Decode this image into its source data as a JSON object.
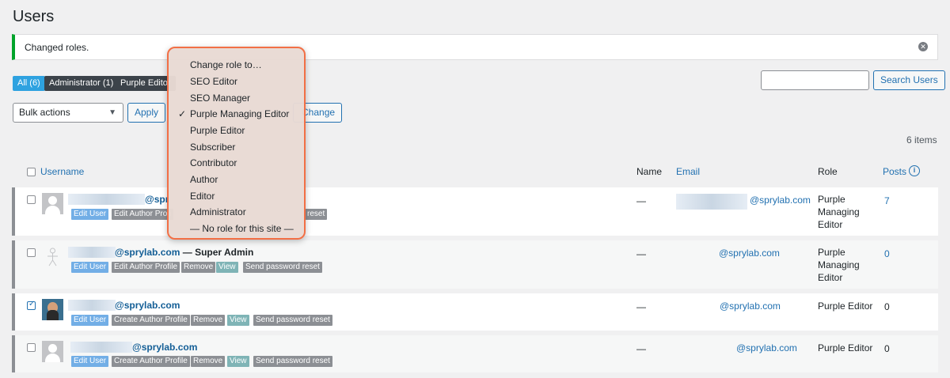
{
  "page": {
    "title": "Users"
  },
  "notice": {
    "text": "Changed roles."
  },
  "filters": [
    {
      "label": "All (6)"
    },
    {
      "label": "Administrator (1)"
    },
    {
      "label": "Purple Editor"
    }
  ],
  "search": {
    "button_label": "Search Users",
    "value": ""
  },
  "bulk": {
    "select_value": "Bulk actions",
    "apply_label": "Apply",
    "change_label": "Change"
  },
  "items_count": "6 items",
  "table": {
    "headers": {
      "username": "Username",
      "name": "Name",
      "email": "Email",
      "role": "Role",
      "posts": "Posts"
    },
    "rows": [
      {
        "username": "@spr",
        "suffix": "",
        "name": "—",
        "email": "@sprylab.com",
        "role": [
          "Purple",
          "Managing",
          "Editor"
        ],
        "posts": "7",
        "actions": [
          "Edit User",
          "Edit Author Profi",
          "reset"
        ]
      },
      {
        "username": "@sprylab.com",
        "suffix": " — Super Admin",
        "name": "—",
        "email": "@sprylab.com",
        "role": [
          "Purple",
          "Managing",
          "Editor"
        ],
        "posts": "0",
        "actions": [
          "Edit User",
          "Edit Author Profile",
          "Remove",
          "View",
          "Send password reset"
        ]
      },
      {
        "username": "@sprylab.com",
        "suffix": "",
        "name": "—",
        "email": "@sprylab.com",
        "role": [
          "Purple Editor"
        ],
        "posts": "0",
        "actions": [
          "Edit User",
          "Create Author Profile",
          "Remove",
          "View",
          "Send password reset"
        ]
      },
      {
        "username": "@sprylab.com",
        "suffix": "",
        "name": "—",
        "email": "@sprylab.com",
        "role": [
          "Purple Editor"
        ],
        "posts": "0",
        "actions": [
          "Edit User",
          "Create Author Profile",
          "Remove",
          "View",
          "Send password reset"
        ]
      }
    ]
  },
  "role_dropdown": {
    "items": [
      {
        "label": "Change role to…",
        "checked": false
      },
      {
        "label": "SEO Editor",
        "checked": false
      },
      {
        "label": "SEO Manager",
        "checked": false
      },
      {
        "label": "Purple Managing Editor",
        "checked": true
      },
      {
        "label": "Purple Editor",
        "checked": false
      },
      {
        "label": "Subscriber",
        "checked": false
      },
      {
        "label": "Contributor",
        "checked": false
      },
      {
        "label": "Author",
        "checked": false
      },
      {
        "label": "Editor",
        "checked": false
      },
      {
        "label": "Administrator",
        "checked": false
      },
      {
        "label": "— No role for this site —",
        "checked": false
      }
    ],
    "check_glyph": "✓"
  },
  "colors": {
    "accent": "#2271b1",
    "success": "#00a32a",
    "highlight_border": "#f26f45"
  }
}
